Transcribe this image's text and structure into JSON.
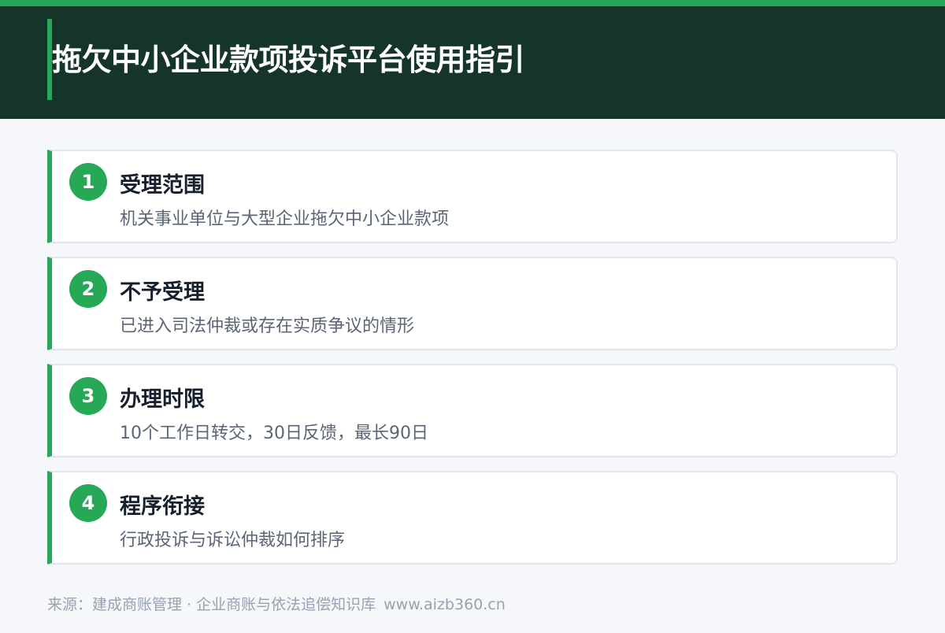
{
  "header": {
    "title": "拖欠中小企业款项投诉平台使用指引"
  },
  "steps": [
    {
      "number": "1",
      "title": "受理范围",
      "description": "机关事业单位与大型企业拖欠中小企业款项"
    },
    {
      "number": "2",
      "title": "不予受理",
      "description": "已进入司法仲裁或存在实质争议的情形"
    },
    {
      "number": "3",
      "title": "办理时限",
      "description": "10个工作日转交，30日反馈，最长90日"
    },
    {
      "number": "4",
      "title": "程序衔接",
      "description": "行政投诉与诉讼仲裁如何排序"
    }
  ],
  "footer": {
    "source": "来源：建成商账管理 · 企业商账与依法追偿知识库",
    "url": "www.aizb360.cn"
  },
  "colors": {
    "accent": "#27a857",
    "header_bg": "#15352b",
    "page_bg": "#f5f7fa",
    "card_border": "#e1e6ee",
    "title_text": "#16202d",
    "desc_text": "#5b6575",
    "footer_text": "#98a2b1"
  }
}
